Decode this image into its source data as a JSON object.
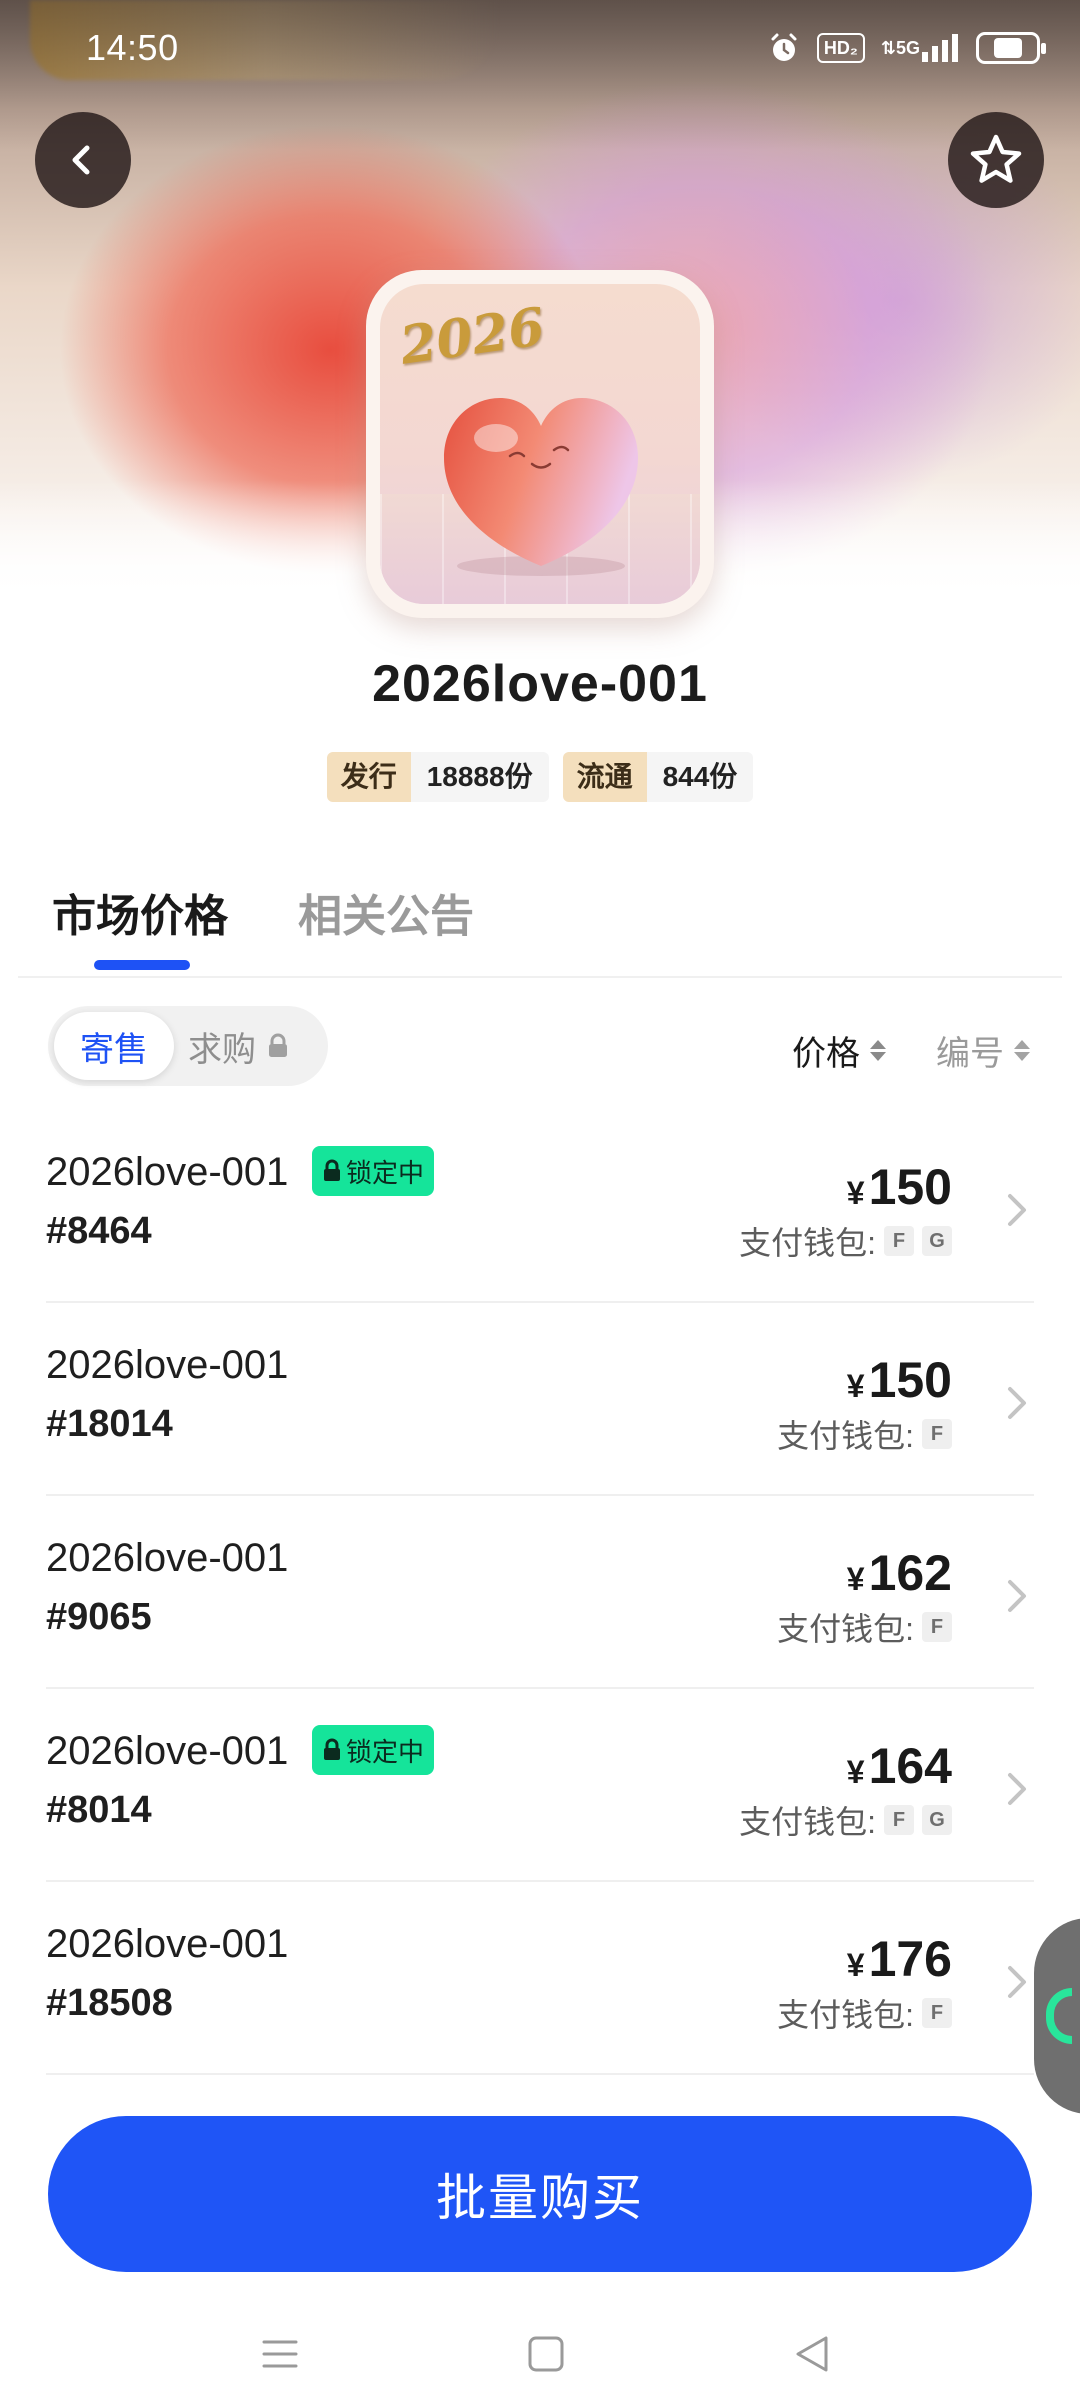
{
  "status_bar": {
    "time": "14:50",
    "icons": [
      "alarm-icon",
      "hd-voice-icon",
      "5g-signal-icon",
      "battery-icon"
    ],
    "hd_label": "HD₂",
    "network_label": "⇅5G",
    "battery_level": 0.55
  },
  "header": {
    "back_icon": "chevron-left-icon",
    "favorite_icon": "star-outline-icon"
  },
  "artwork": {
    "year_text": "2026"
  },
  "collection": {
    "title": "2026love-001",
    "stats": [
      {
        "label": "发行",
        "value": "18888份"
      },
      {
        "label": "流通",
        "value": "844份"
      }
    ]
  },
  "tabs": [
    {
      "label": "市场价格",
      "active": true
    },
    {
      "label": "相关公告",
      "active": false
    }
  ],
  "filter": {
    "segments": [
      {
        "label": "寄售",
        "active": true
      },
      {
        "label": "求购",
        "active": false,
        "locked": true
      }
    ],
    "sort_price": "价格",
    "sort_number": "编号"
  },
  "listings": [
    {
      "name": "2026love-001",
      "serial": "#8464",
      "locked": true,
      "lock_label": "锁定中",
      "currency": "¥",
      "price": "150",
      "wallet_label": "支付钱包:",
      "wallets": [
        "F",
        "G"
      ]
    },
    {
      "name": "2026love-001",
      "serial": "#18014",
      "locked": false,
      "lock_label": "",
      "currency": "¥",
      "price": "150",
      "wallet_label": "支付钱包:",
      "wallets": [
        "F"
      ]
    },
    {
      "name": "2026love-001",
      "serial": "#9065",
      "locked": false,
      "lock_label": "",
      "currency": "¥",
      "price": "162",
      "wallet_label": "支付钱包:",
      "wallets": [
        "F"
      ]
    },
    {
      "name": "2026love-001",
      "serial": "#8014",
      "locked": true,
      "lock_label": "锁定中",
      "currency": "¥",
      "price": "164",
      "wallet_label": "支付钱包:",
      "wallets": [
        "F",
        "G"
      ]
    },
    {
      "name": "2026love-001",
      "serial": "#18508",
      "locked": false,
      "lock_label": "",
      "currency": "¥",
      "price": "176",
      "wallet_label": "支付钱包:",
      "wallets": [
        "F"
      ]
    }
  ],
  "cta": {
    "label": "批量购买"
  },
  "colors": {
    "accent": "#1f55f6",
    "lock_badge": "#15e49a",
    "stat_label_bg": "#f4dfbd"
  },
  "navbar": {
    "icons": [
      "menu-icon",
      "home-square-icon",
      "back-triangle-icon"
    ]
  }
}
